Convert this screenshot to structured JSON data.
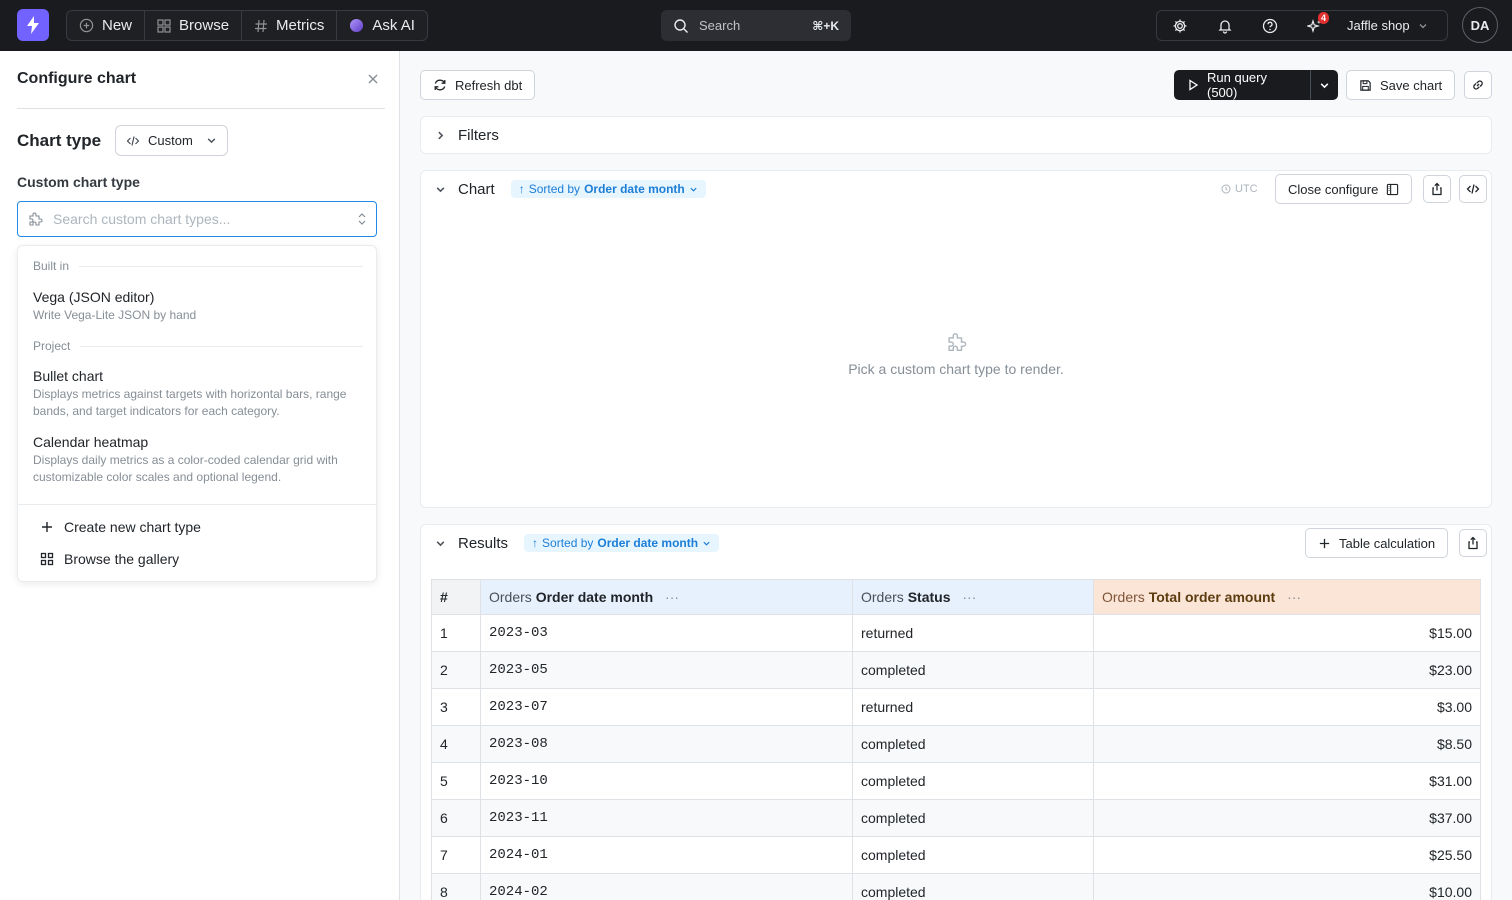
{
  "topbar": {
    "nav": [
      {
        "label": "New",
        "icon": "plus-circle-icon"
      },
      {
        "label": "Browse",
        "icon": "grid-icon"
      },
      {
        "label": "Metrics",
        "icon": "hash-icon"
      },
      {
        "label": "Ask AI",
        "icon": "ai-orb-icon"
      }
    ],
    "search_label": "Search",
    "search_shortcut": "⌘+K",
    "notifications_badge": "4",
    "project_name": "Jaffle shop",
    "avatar_initials": "DA"
  },
  "config_panel": {
    "title": "Configure chart",
    "chart_type_label": "Chart type",
    "chart_type_value": "Custom",
    "custom_chart_type_label": "Custom chart type",
    "search_placeholder": "Search custom chart types...",
    "groups": [
      {
        "label": "Built in",
        "items": [
          {
            "title": "Vega (JSON editor)",
            "description": "Write Vega-Lite JSON by hand"
          }
        ]
      },
      {
        "label": "Project",
        "items": [
          {
            "title": "Bullet chart",
            "description": "Displays metrics against targets with horizontal bars, range bands, and target indicators for each category."
          },
          {
            "title": "Calendar heatmap",
            "description": "Displays daily metrics as a color-coded calendar grid with customizable color scales and optional legend."
          }
        ]
      }
    ],
    "actions": [
      {
        "label": "Create new chart type",
        "icon": "plus-icon"
      },
      {
        "label": "Browse the gallery",
        "icon": "gallery-grid-icon"
      }
    ]
  },
  "toolbar": {
    "refresh_label": "Refresh dbt",
    "run_query_label": "Run query (500)",
    "save_chart_label": "Save chart"
  },
  "filters": {
    "label": "Filters"
  },
  "chart_card": {
    "label": "Chart",
    "sort_prefix": "Sorted by",
    "sort_field": "Order date month",
    "timezone": "UTC",
    "close_configure_label": "Close configure",
    "empty_message": "Pick a custom chart type to render."
  },
  "results": {
    "label": "Results",
    "sort_prefix": "Sorted by",
    "sort_field": "Order date month",
    "table_calc_label": "Table calculation",
    "columns": [
      {
        "table": "#",
        "field": ""
      },
      {
        "table": "Orders",
        "field": "Order date month"
      },
      {
        "table": "Orders",
        "field": "Status"
      },
      {
        "table": "Orders",
        "field": "Total order amount"
      }
    ],
    "rows": [
      [
        "1",
        "2023-03",
        "returned",
        "$15.00"
      ],
      [
        "2",
        "2023-05",
        "completed",
        "$23.00"
      ],
      [
        "3",
        "2023-07",
        "returned",
        "$3.00"
      ],
      [
        "4",
        "2023-08",
        "completed",
        "$8.50"
      ],
      [
        "5",
        "2023-10",
        "completed",
        "$31.00"
      ],
      [
        "6",
        "2023-11",
        "completed",
        "$37.00"
      ],
      [
        "7",
        "2024-01",
        "completed",
        "$25.50"
      ],
      [
        "8",
        "2024-02",
        "completed",
        "$10.00"
      ]
    ]
  },
  "colors": {
    "brand": "#7262ff",
    "focus": "#228be6",
    "dimension_header": "#e7f0fd",
    "metric_header": "#fbe5d6"
  }
}
